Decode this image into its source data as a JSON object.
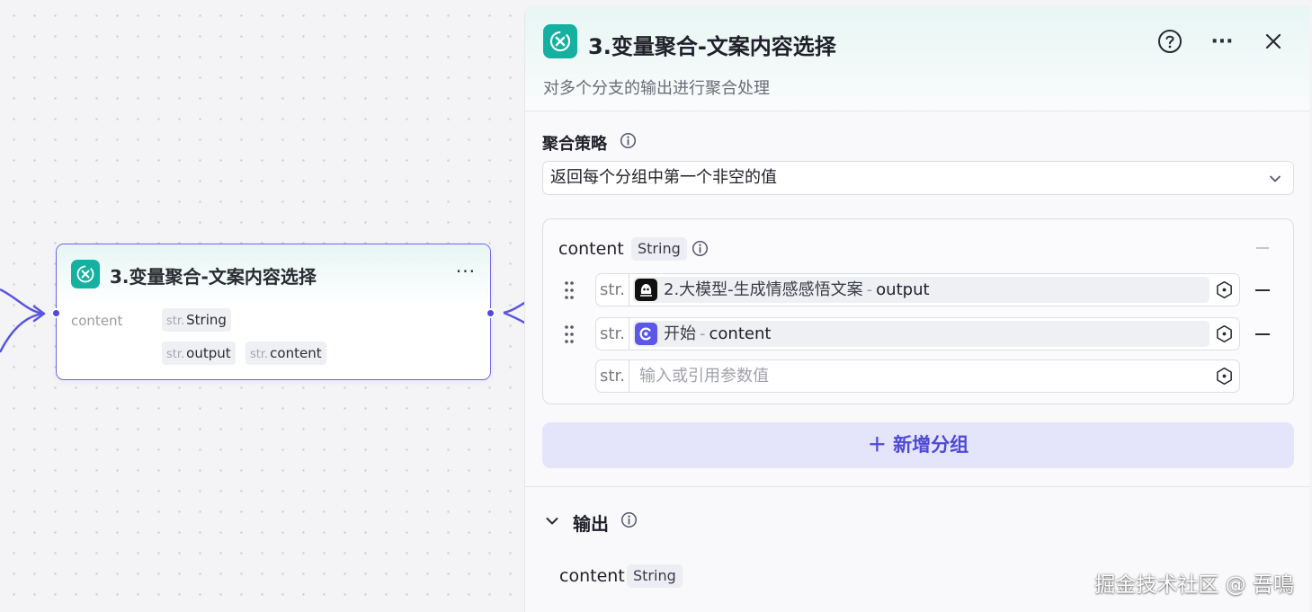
{
  "node": {
    "title": "3.变量聚合-文案内容选择",
    "more": "···",
    "label": "content",
    "type_prefix": "str.",
    "type": "String",
    "var1": "output",
    "var2": "content"
  },
  "panel": {
    "title": "3.变量聚合-文案内容选择",
    "description": "对多个分支的输出进行聚合处理",
    "more": "···",
    "strategy_label": "聚合策略",
    "strategy_value": "返回每个分组中第一个非空的值",
    "group": {
      "name": "content",
      "type": "String",
      "collapse": "—",
      "rows": [
        {
          "prefix": "str.",
          "node": "2.大模型-生成情感感悟文案",
          "sep": "-",
          "field": "output"
        },
        {
          "prefix": "str.",
          "node": "开始",
          "sep": "-",
          "field": "content"
        }
      ],
      "empty_prefix": "str.",
      "placeholder": "输入或引用参数值"
    },
    "add_group_label": "＋ 新增分组",
    "output_label": "输出",
    "output_name": "content",
    "output_type": "String"
  },
  "colors": {
    "accent": "#4f4ad5",
    "edge": "#5a55e0",
    "teal": "#16b0a0"
  },
  "icons": [
    "variable-aggregate-icon",
    "help-icon",
    "more-icon",
    "close-icon",
    "info-icon",
    "chevron-down-icon",
    "drag-handle-icon",
    "variable-icon",
    "llm-node-icon",
    "start-node-icon"
  ],
  "watermark": "掘金技术社区 @ 吾鳴"
}
